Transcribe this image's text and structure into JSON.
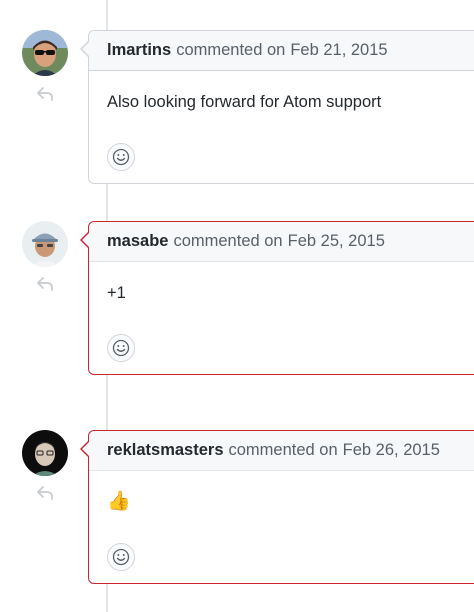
{
  "comments": [
    {
      "author": "lmartins",
      "action": "commented on",
      "date": "Feb 21, 2015",
      "body": "Also looking forward for Atom support",
      "highlighted": false,
      "avatar_icon": "avatar-sunglasses"
    },
    {
      "author": "masabe",
      "action": "commented on",
      "date": "Feb 25, 2015",
      "body": "+1",
      "highlighted": true,
      "avatar_icon": "avatar-cap"
    },
    {
      "author": "reklatsmasters",
      "action": "commented on",
      "date": "Feb 26, 2015",
      "body": "👍",
      "highlighted": true,
      "avatar_icon": "avatar-dark"
    }
  ],
  "icons": {
    "reply": "reply-icon",
    "reaction": "smiley-icon"
  },
  "colors": {
    "highlight_border": "#cb2431",
    "default_border": "#d1d5da",
    "header_bg": "#f6f8fa",
    "muted_text": "#586069"
  }
}
